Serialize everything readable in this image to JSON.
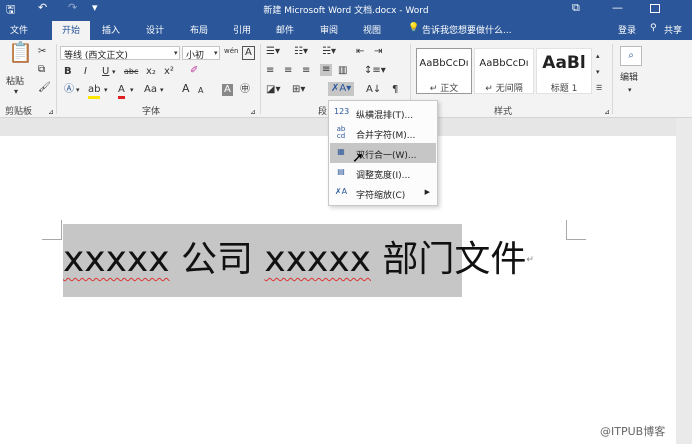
{
  "title": "新建 Microsoft Word 文档.docx - Word",
  "qat": {
    "save": "🖫",
    "undo": "↶",
    "redo": "↷",
    "more": "▾"
  },
  "window": {
    "restore": "⧉",
    "minimize": "—"
  },
  "tabs": [
    "文件",
    "开始",
    "插入",
    "设计",
    "布局",
    "引用",
    "邮件",
    "审阅",
    "视图"
  ],
  "tell_me": "告诉我您想要做什么...",
  "login": "登录",
  "share": "共享",
  "clipboard": {
    "paste": "粘贴",
    "label": "剪贴板"
  },
  "font": {
    "name": "等线 (西文正文)",
    "size": "小初",
    "label": "字体",
    "bold": "B",
    "italic": "I",
    "underline": "U",
    "strike": "abc",
    "sub": "x₂",
    "sup": "x²",
    "case": "Aa",
    "grow": "A",
    "shrink": "A",
    "clear": "A",
    "phonetic": "wén",
    "border_char": "A"
  },
  "paragraph": {
    "label": "段"
  },
  "styles": {
    "label": "样式",
    "items": [
      {
        "preview": "AaBbCcDı",
        "name": "↵ 正文"
      },
      {
        "preview": "AaBbCcDı",
        "name": "↵ 无间隔"
      },
      {
        "preview": "AaBl",
        "name": "标题 1"
      }
    ]
  },
  "editing": {
    "label": "编辑"
  },
  "menu": {
    "items": [
      {
        "icon": "123",
        "label": "纵横混排(T)..."
      },
      {
        "icon": "ab cd",
        "label": "合并字符(M)..."
      },
      {
        "icon": "▦",
        "label": "双行合一(W)..."
      },
      {
        "icon": "▤",
        "label": "调整宽度(I)..."
      },
      {
        "icon": "✗A",
        "label": "字符缩放(C)",
        "arrow": "▶"
      }
    ]
  },
  "document": {
    "seg1": "xxxxx",
    "seg2": " 公司 ",
    "seg3": "xxxxx",
    "seg4": " 部门文件",
    "mark": "↵"
  },
  "watermark": "@ITPUB博客"
}
